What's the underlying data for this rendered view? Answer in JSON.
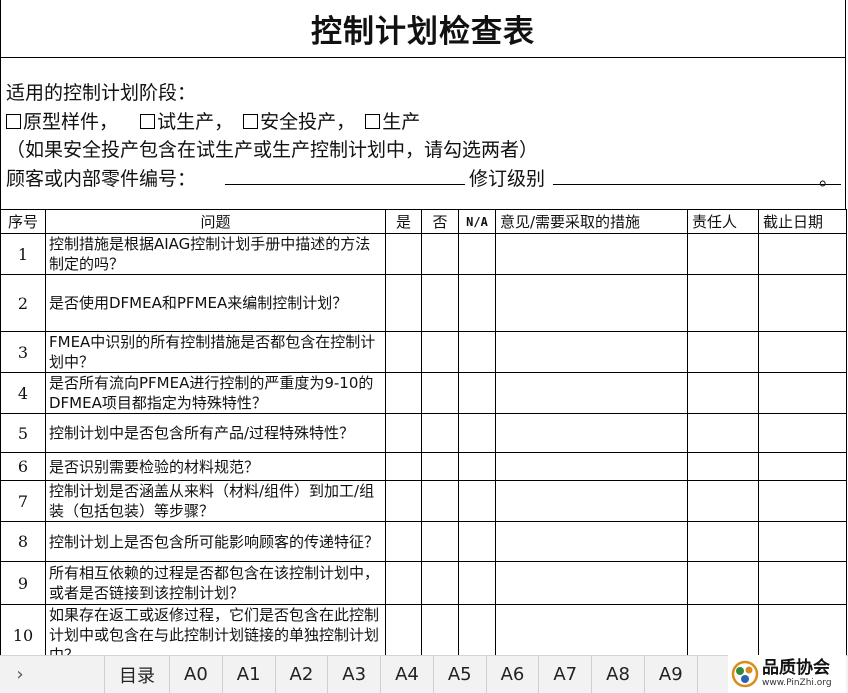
{
  "title": "控制计划检查表",
  "intro": {
    "stage_label": "适用的控制计划阶段：",
    "options": [
      "原型样件，",
      "试生产，",
      "安全投产，",
      "生产"
    ],
    "note": "（如果安全投产包含在试生产或生产控制计划中，请勾选两者）",
    "part_no_label": "顾客或内部零件编号：",
    "revision_label": "修订级别",
    "end_mark": "。"
  },
  "table": {
    "headers": {
      "no": "序号",
      "question": "问题",
      "yes": "是",
      "no_ans": "否",
      "na": "N/A",
      "action": "意见/需要采取的措施",
      "owner": "责任人",
      "due": "截止日期"
    },
    "rows": [
      {
        "no": "1",
        "q": "控制措施是根据AIAG控制计划手册中描述的方法制定的吗？"
      },
      {
        "no": "2",
        "q": "是否使用DFMEA和PFMEA来编制控制计划？"
      },
      {
        "no": "3",
        "q": "FMEA中识别的所有控制措施是否都包含在控制计划中？"
      },
      {
        "no": "4",
        "q": "是否所有流向PFMEA进行控制的严重度为9-10的DFMEA项目都指定为特殊特性？"
      },
      {
        "no": "5",
        "q": "控制计划中是否包含所有产品/过程特殊特性？"
      },
      {
        "no": "6",
        "q": "是否识别需要检验的材料规范？"
      },
      {
        "no": "7",
        "q": "控制计划是否涵盖从来料（材料/组件）到加工/组装（包括包装）等步骤？"
      },
      {
        "no": "8",
        "q": "控制计划上是否包含所可能影响顾客的传递特征？"
      },
      {
        "no": "9",
        "q": "所有相互依赖的过程是否都包含在该控制计划中，或者是否链接到该控制计划？"
      },
      {
        "no": "10",
        "q": "如果存在返工或返修过程，它们是否包含在此控制计划中或包含在与此控制计划链接的单独控制计划中？"
      }
    ]
  },
  "sheet_tabs": [
    "目录",
    "A0",
    "A1",
    "A2",
    "A3",
    "A4",
    "A5",
    "A6",
    "A7",
    "A8",
    "A9"
  ],
  "nav_arrow": "›",
  "logo": {
    "name": "品质协会",
    "url": "www.PinZhi.org",
    "icon": "pinzhi-logo-icon"
  }
}
